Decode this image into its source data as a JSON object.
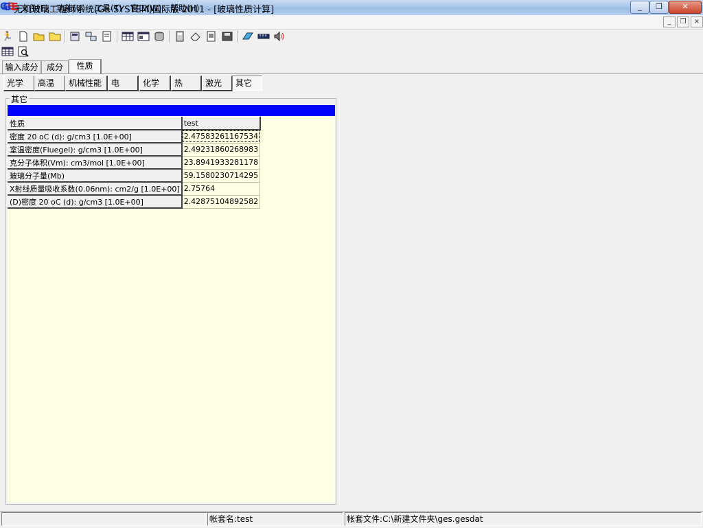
{
  "window": {
    "title": "无机玻璃工程师系统(GE-SYSTEM)国际版 2011 - [玻璃性质计算]",
    "logo_text_g": "G",
    "logo_text_e": "E",
    "controls": {
      "minimize": "_",
      "restore": "❐",
      "close": "✕"
    }
  },
  "menu": {
    "items": [
      "文件(F)",
      "功能(U)",
      "工具(T)",
      "窗口(W)",
      "帮助(H)"
    ],
    "mdi_controls": {
      "minimize": "_",
      "restore": "❐",
      "close": "×"
    }
  },
  "toolbar": {
    "row1": [
      "run-icon",
      "new-file-icon",
      "open-folder-icon",
      "folder-icon",
      "calc-icon",
      "network-icon",
      "print-preview-icon",
      "table-icon",
      "grid-icon",
      "database-icon",
      "calculator-icon",
      "eraser-icon",
      "document-icon",
      "disk-icon",
      "book-icon",
      "ruler-icon",
      "speaker-icon"
    ],
    "row2": [
      "spreadsheet-icon",
      "preview-icon"
    ]
  },
  "tabs": {
    "top": [
      "输入成分",
      "成分",
      "性质"
    ],
    "top_active": "性质",
    "sub": [
      "光学",
      "高温",
      "机械性能",
      "电",
      "化学",
      "热",
      "激光",
      "其它"
    ],
    "sub_active": "其它"
  },
  "group": {
    "title": "其它",
    "table": {
      "header": [
        "性质",
        "test"
      ],
      "rows": [
        [
          "密度 20 oC  (d): g/cm3 [1.0E+00]",
          "2.47583261167534"
        ],
        [
          "室温密度(Fluegel): g/cm3 [1.0E+00]",
          "2.49231860268983"
        ],
        [
          "克分子体积(Vm): cm3/mol [1.0E+00]",
          "23.8941933281178"
        ],
        [
          "玻璃分子量(Mb)",
          "59.1580230714295"
        ],
        [
          "X射线质量吸收系数(0.06nm): cm2/g [1.0E+00]",
          "2.75764"
        ],
        [
          "(D)密度 20 oC  (d): g/cm3 [1.0E+00]",
          "2.42875104892582"
        ]
      ]
    }
  },
  "colors": {
    "header_bar": "#0000ff",
    "grid_bg": "#fefee4"
  },
  "status": {
    "panel1": "",
    "panel2": "帐套名:test",
    "panel3": "帐套文件:C:\\新建文件夹\\ges.gesdat"
  }
}
